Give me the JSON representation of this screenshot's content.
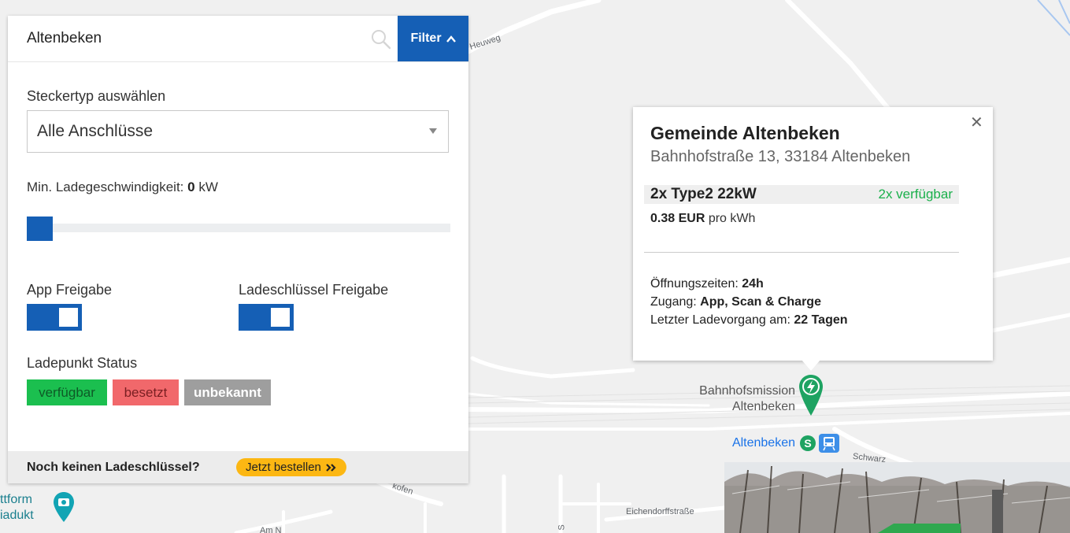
{
  "search": {
    "value": "Altenbeken"
  },
  "filter_button": {
    "label": "Filter"
  },
  "filters": {
    "plug_type_label": "Steckertyp auswählen",
    "plug_type_selected": "Alle Anschlüsse",
    "min_speed_label": "Min. Ladegeschwindigkeit:",
    "min_speed_value": "0",
    "min_speed_unit": "kW",
    "min_speed_slider_fraction": 0,
    "app_release_label": "App Freigabe",
    "app_release_on": true,
    "key_release_label": "Ladeschlüssel Freigabe",
    "key_release_on": true,
    "status_label": "Ladepunkt Status",
    "status_chips": [
      "verfügbar",
      "besetzt",
      "unbekannt"
    ]
  },
  "footer": {
    "text": "Noch keinen Ladeschlüssel?",
    "order_label": "Jetzt bestellen"
  },
  "popup": {
    "title": "Gemeinde Altenbeken",
    "address": "Bahnhofstraße 13, 33184 Altenbeken",
    "connector": "2x Type2 22kW",
    "availability": "2x verfügbar",
    "price_value": "0.38 EUR",
    "price_unit": "pro kWh",
    "opening_label": "Öffnungszeiten:",
    "opening_value": "24h",
    "access_label": "Zugang:",
    "access_value": "App, Scan & Charge",
    "last_charge_label": "Letzter Ladevorgang am:",
    "last_charge_value": "22 Tagen",
    "close_icon": "close-icon"
  },
  "map": {
    "street_heuweg": "Heuweg",
    "street_eichendorff": "Eichendorffstraße",
    "street_schwarz": "Schwarz",
    "street_kofen": "kofen",
    "street_am_nw": "Am N",
    "street_s": "S",
    "poi_mission_line1": "Bahnhofsmission",
    "poi_mission_line2": "Altenbeken",
    "poi_station": "Altenbeken",
    "poi_plattform_line1": "ttform",
    "poi_plattform_line2": "iadukt"
  },
  "colors": {
    "primary": "#155fb5",
    "available": "#1bbf4f",
    "busy": "#f1686b",
    "unknown": "#9e9e9e",
    "order": "#fcb713",
    "charger_pin": "#1ea362"
  }
}
